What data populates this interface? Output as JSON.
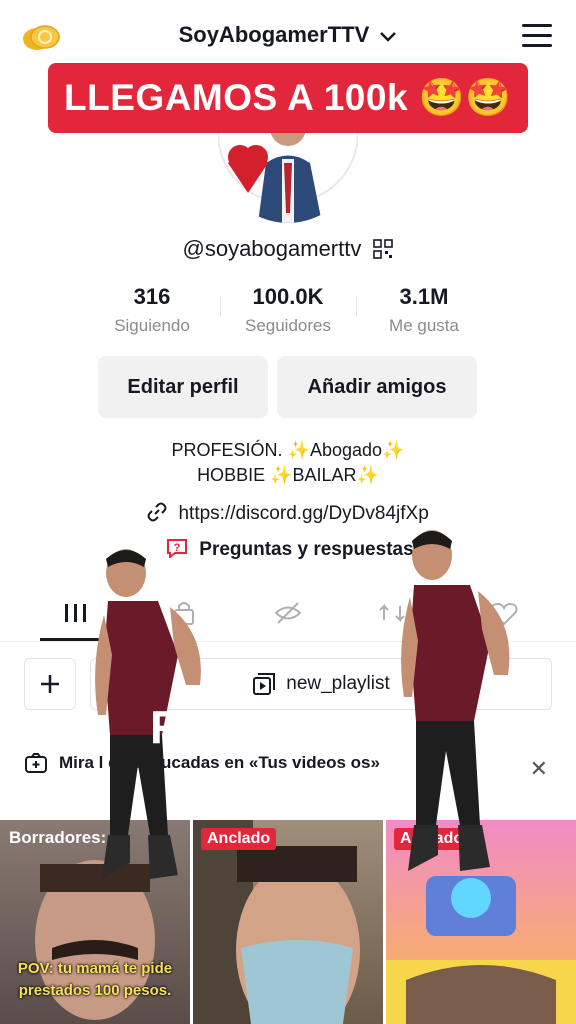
{
  "header": {
    "username": "SoyAbogamerTTV",
    "coin_icon": "coin-icon",
    "menu_icon": "hamburger-menu-icon"
  },
  "banner": {
    "text": "LLEGAMOS A 100k 🤩🤩"
  },
  "profile": {
    "handle": "@soyabogamerttv"
  },
  "stats": [
    {
      "value": "316",
      "label": "Siguiendo"
    },
    {
      "value": "100.0K",
      "label": "Seguidores"
    },
    {
      "value": "3.1M",
      "label": "Me gusta"
    }
  ],
  "actions": {
    "edit": "Editar perfil",
    "add_friends": "Añadir amigos"
  },
  "bio": {
    "line1": "PROFESIÓN. ✨Abogado✨",
    "line2": "HOBBIE ✨BAILAR✨"
  },
  "link": {
    "url": "https://discord.gg/DyDv84jfXp"
  },
  "qa": {
    "label": "Preguntas y respuestas"
  },
  "playlist": {
    "label": "new_playlist"
  },
  "notice": {
    "text": "Mira l      es caducadas en «Tus videos                os»"
  },
  "overlay": {
    "text": "R          s"
  },
  "grid": [
    {
      "badge": "Borradores: 4",
      "caption_line1": "POV: tu mamá te pide",
      "caption_line2": "prestados 100 pesos."
    },
    {
      "badge": "Anclado"
    },
    {
      "badge": "Anclado"
    }
  ],
  "colors": {
    "accent": "#e2263b",
    "text": "#161823",
    "muted": "#8a8b91",
    "button_bg": "#f1f1f2"
  }
}
